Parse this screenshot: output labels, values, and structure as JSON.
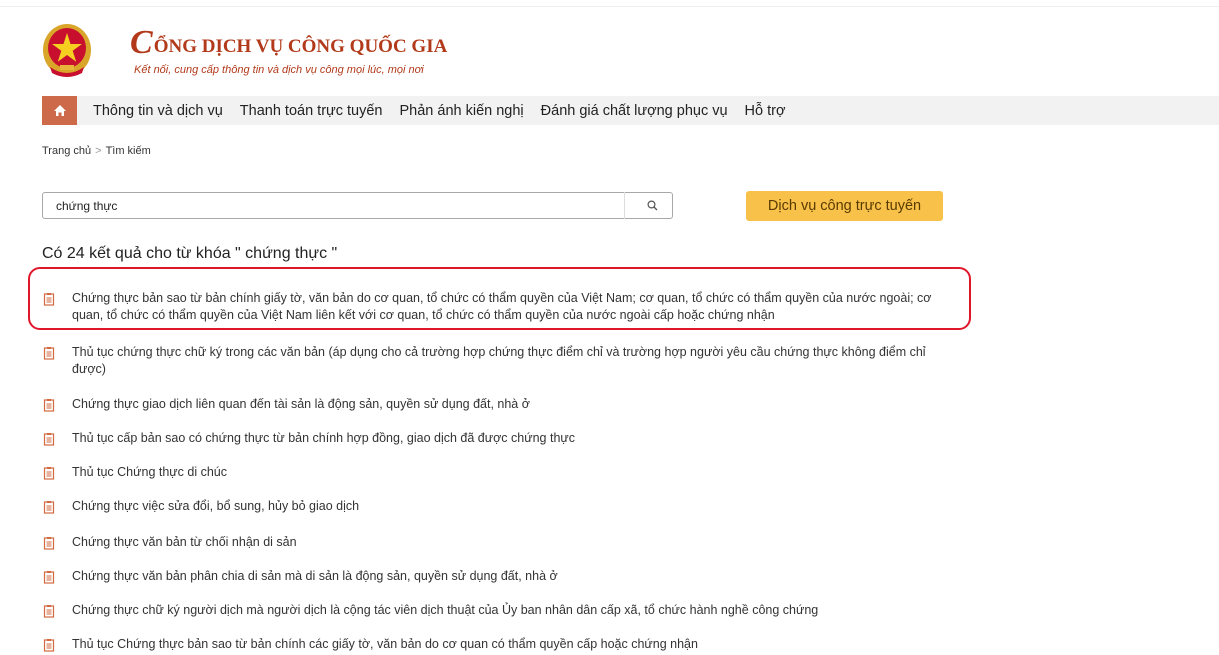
{
  "header": {
    "logo_initial": "C",
    "logo_title": "ỔNG DỊCH VỤ CÔNG QUỐC GIA",
    "logo_subtitle": "Kết nối, cung cấp thông tin và dịch vụ công mọi lúc, mọi nơi",
    "emblem_icon": "vietnam-national-emblem",
    "colors": {
      "brand": "#b23a1a"
    }
  },
  "nav": {
    "home_icon": "home-icon",
    "items": [
      {
        "label": "Thông tin và dịch vụ"
      },
      {
        "label": "Thanh toán trực tuyến"
      },
      {
        "label": "Phản ánh kiến nghị"
      },
      {
        "label": "Đánh giá chất lượng phục vụ"
      },
      {
        "label": "Hỗ trợ"
      }
    ],
    "colors": {
      "home_bg": "#cd6a4a",
      "bar_bg": "#f2f2f2"
    }
  },
  "breadcrumb": {
    "home": "Trang chủ",
    "separator": ">",
    "current": "Tìm kiếm"
  },
  "search": {
    "value": "chứng thực",
    "button_icon": "search-icon"
  },
  "dvc_button": {
    "label": "Dịch vụ công trực tuyến",
    "color": "#f8c14a"
  },
  "results": {
    "heading": "Có 24 kết quả cho từ khóa \" chứng thực \"",
    "item_icon": "document-icon",
    "highlight_color": "#e0172b",
    "items": [
      {
        "title": "Chứng thực bản sao từ bản chính giấy tờ, văn bản do cơ quan, tổ chức có thẩm quyền của Việt Nam; cơ quan, tổ chức có thẩm quyền của nước ngoài; cơ quan, tổ chức có thẩm quyền của Việt Nam liên kết với cơ quan, tổ chức có thẩm quyền của nước ngoài cấp hoặc chứng nhận"
      },
      {
        "title": "Thủ tục chứng thực chữ ký trong các văn bản (áp dụng cho cả trường hợp chứng thực điểm chỉ và trường hợp người yêu cầu chứng thực không điểm chỉ được)"
      },
      {
        "title": "Chứng thực giao dịch liên quan đến tài sản là động sản, quyền sử dụng đất, nhà ở"
      },
      {
        "title": "Thủ tục cấp bản sao có chứng thực từ bản chính hợp đồng, giao dịch đã được chứng thực"
      },
      {
        "title": "Thủ tục Chứng thực di chúc"
      },
      {
        "title": "Chứng thực việc sửa đổi, bổ sung, hủy bỏ giao dịch"
      },
      {
        "title": "Chứng thực văn bản từ chối nhận di sản"
      },
      {
        "title": "Chứng thực văn bản phân chia di sản mà di sản là động sản, quyền sử dụng đất, nhà ở"
      },
      {
        "title": "Chứng thực chữ ký người dịch mà người dịch là cộng tác viên dịch thuật của Ủy ban nhân dân cấp xã, tổ chức hành nghề công chứng"
      },
      {
        "title": "Thủ tục Chứng thực bản sao từ bản chính các giấy tờ, văn bản do cơ quan có thẩm quyền cấp hoặc chứng nhận"
      }
    ]
  }
}
